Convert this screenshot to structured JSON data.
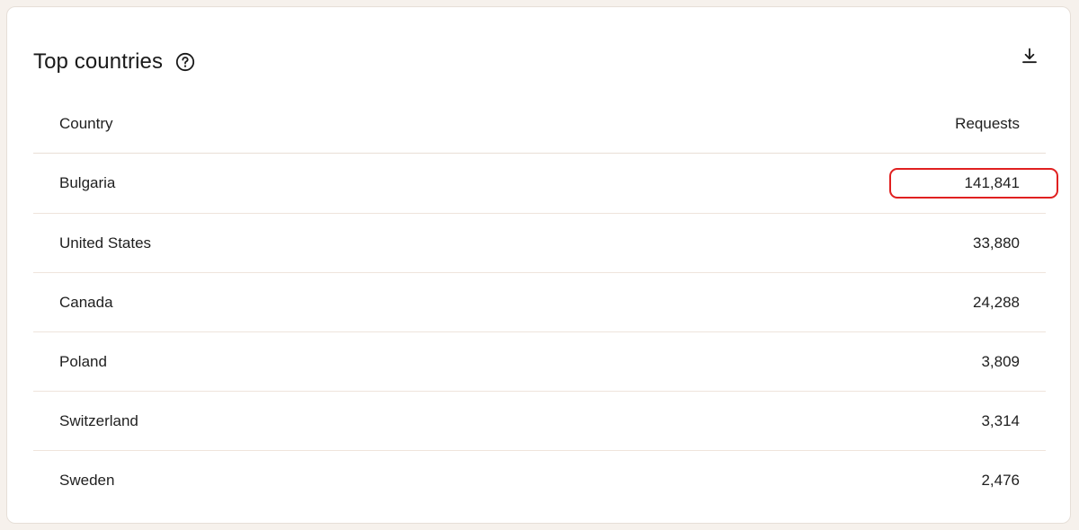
{
  "card": {
    "title": "Top countries",
    "help_icon": "question-circle-icon",
    "download_icon": "download-icon"
  },
  "table": {
    "columns": [
      "Country",
      "Requests"
    ],
    "rows": [
      {
        "country": "Bulgaria",
        "requests": "141,841"
      },
      {
        "country": "United States",
        "requests": "33,880"
      },
      {
        "country": "Canada",
        "requests": "24,288"
      },
      {
        "country": "Poland",
        "requests": "3,809"
      },
      {
        "country": "Switzerland",
        "requests": "3,314"
      },
      {
        "country": "Sweden",
        "requests": "2,476"
      }
    ]
  },
  "colors": {
    "highlight": "#e02020",
    "row_divider": "#efe4dc",
    "page_background": "#f6f1ec"
  }
}
